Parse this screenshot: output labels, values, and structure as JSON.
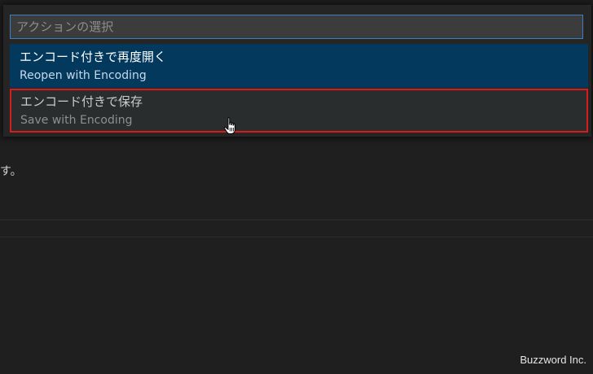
{
  "editor": {
    "visible_text": "す。"
  },
  "quick_pick": {
    "placeholder": "アクションの選択",
    "items": [
      {
        "label": "エンコード付きで再度開く",
        "detail": "Reopen with Encoding",
        "state": "selected"
      },
      {
        "label": "エンコード付きで保存",
        "detail": "Save with Encoding",
        "state": "hovered"
      }
    ]
  },
  "cursor": {
    "icon": "hand-pointer-icon"
  },
  "watermark": {
    "text": "Buzzword Inc."
  },
  "colors": {
    "editor_background": "#1f1f1f",
    "widget_background": "#252526",
    "selected_item": "#04395e",
    "input_border": "#3c7fc1",
    "highlight_box": "#d81b1b"
  }
}
